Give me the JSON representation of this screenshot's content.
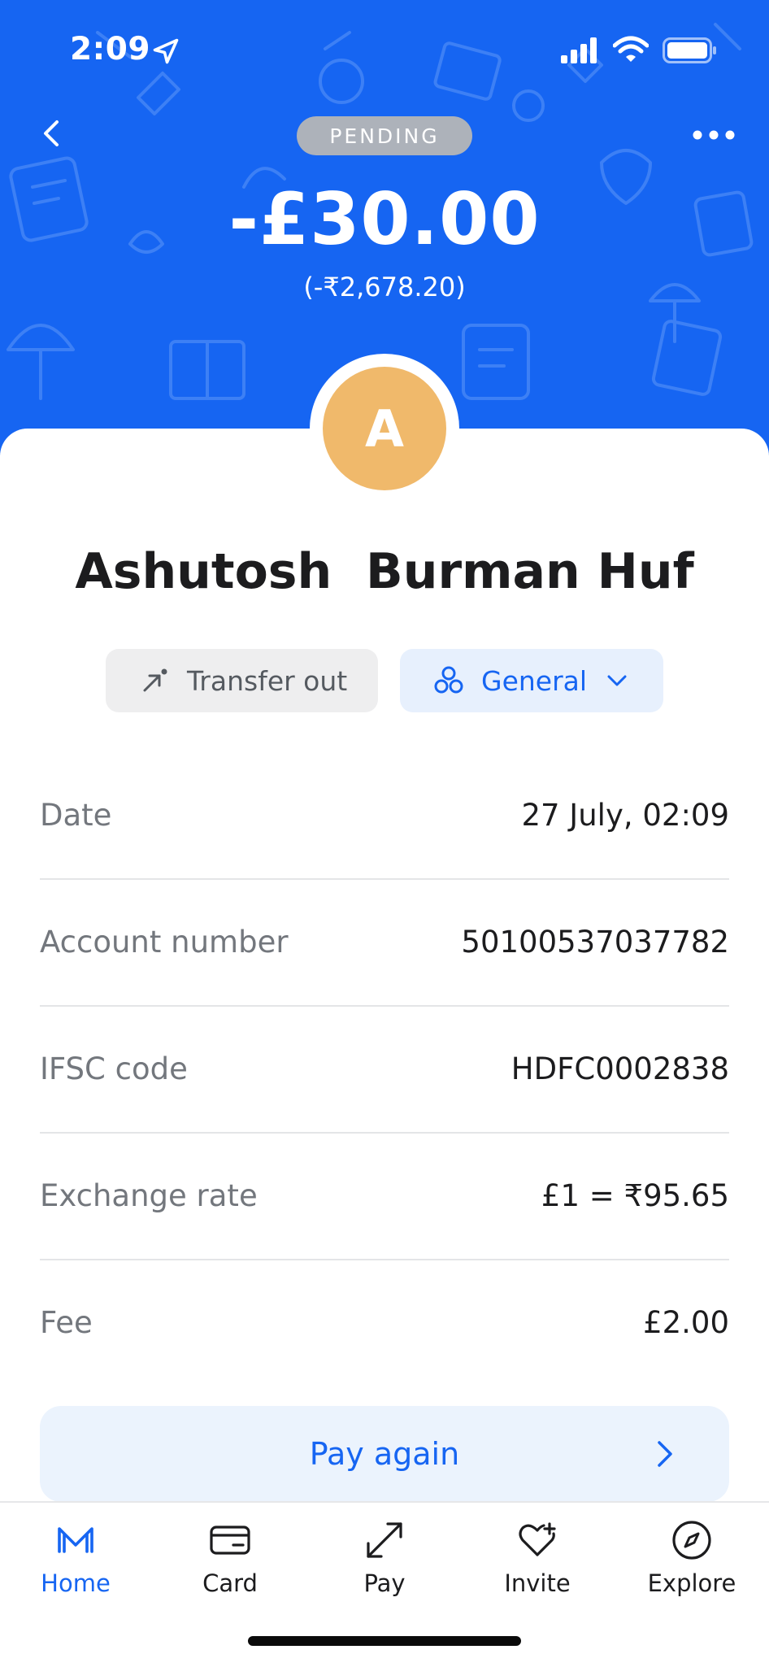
{
  "status_bar": {
    "time": "2:09"
  },
  "header": {
    "status": "PENDING",
    "amount": "-£30.00",
    "amount_local": "(-₹2,678.20)",
    "avatar_initial": "A",
    "background_color": "#1665f2"
  },
  "payee": {
    "name": "Ashutosh  Burman Huf"
  },
  "chips": {
    "type_label": "Transfer out",
    "category_label": "General"
  },
  "details": [
    {
      "label": "Date",
      "value": "27 July, 02:09"
    },
    {
      "label": "Account number",
      "value": "50100537037782"
    },
    {
      "label": "IFSC code",
      "value": "HDFC0002838"
    },
    {
      "label": "Exchange rate",
      "value": "£1 = ₹95.65"
    },
    {
      "label": "Fee",
      "value": "£2.00"
    }
  ],
  "actions": {
    "pay_again": "Pay again"
  },
  "tabbar": {
    "items": [
      {
        "label": "Home",
        "icon": "monzo-logo-icon",
        "active": true
      },
      {
        "label": "Card",
        "icon": "card-icon",
        "active": false
      },
      {
        "label": "Pay",
        "icon": "pay-arrows-icon",
        "active": false
      },
      {
        "label": "Invite",
        "icon": "heart-plus-icon",
        "active": false
      },
      {
        "label": "Explore",
        "icon": "compass-icon",
        "active": false
      }
    ]
  },
  "colors": {
    "accent": "#1665f2",
    "avatar": "#f0b96b",
    "pending_pill": "#adb2ba"
  }
}
